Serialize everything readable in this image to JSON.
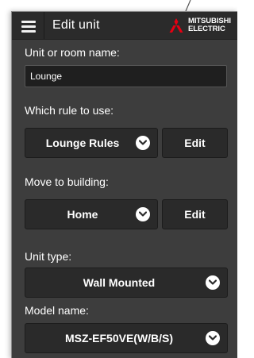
{
  "header": {
    "title": "Edit unit",
    "menu_icon": "hamburger-menu-icon",
    "brand": {
      "name_line1": "MITSUBISHI",
      "name_line2": "ELECTRIC",
      "logo_icon": "three-diamonds-logo",
      "logo_color": "#e60012"
    }
  },
  "form": {
    "unit_name": {
      "label": "Unit or room name:",
      "value": "Lounge"
    },
    "rule": {
      "label": "Which rule to use:",
      "selected": "Lounge Rules",
      "edit_label": "Edit"
    },
    "building": {
      "label": "Move to building:",
      "selected": "Home",
      "edit_label": "Edit"
    },
    "unit_type": {
      "label": "Unit type:",
      "selected": "Wall Mounted"
    },
    "model": {
      "label": "Model name:",
      "selected": "MSZ-EF50VE(W/B/S)"
    }
  },
  "colors": {
    "panel_bg": "#3d3d3d",
    "header_bg": "#2b2b2b",
    "control_bg": "#2a2a2a",
    "text": "#ffffff"
  }
}
